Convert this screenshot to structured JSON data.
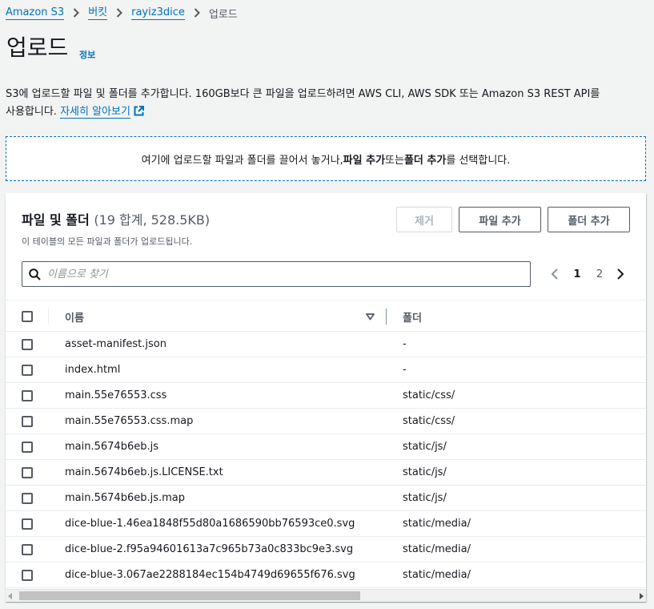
{
  "breadcrumb": {
    "items": [
      "Amazon S3",
      "버킷",
      "rayiz3dice"
    ],
    "current": "업로드"
  },
  "page": {
    "title": "업로드",
    "info": "정보"
  },
  "description": {
    "line1": "S3에 업로드할 파일 및 폴더를 추가합니다. 160GB보다 큰 파일을 업로드하려면 AWS CLI, AWS SDK 또는 Amazon S3 REST API를",
    "line2": "사용합니다.",
    "more_link": "자세히 알아보기"
  },
  "dropzone": {
    "pre": "여기에 업로드할 파일과 폴더를 끌어서 놓거나, ",
    "add_files": "파일 추가",
    "mid": " 또는 ",
    "add_folder": "폴더 추가",
    "post": "를 선택합니다."
  },
  "panel": {
    "title": "파일 및 폴더",
    "count": "(19 합계, 528.5KB)",
    "subtitle": "이 테이블의 모든 파일과 폴더가 업로드됩니다.",
    "remove_label": "제거",
    "add_files_label": "파일 추가",
    "add_folder_label": "폴더 추가"
  },
  "search": {
    "placeholder": "이름으로 찾기"
  },
  "pagination": {
    "pages": [
      "1",
      "2"
    ],
    "current": "1"
  },
  "table": {
    "columns": {
      "name": "이름",
      "folder": "폴더"
    },
    "rows": [
      {
        "name": "asset-manifest.json",
        "folder": "-"
      },
      {
        "name": "index.html",
        "folder": "-"
      },
      {
        "name": "main.55e76553.css",
        "folder": "static/css/"
      },
      {
        "name": "main.55e76553.css.map",
        "folder": "static/css/"
      },
      {
        "name": "main.5674b6eb.js",
        "folder": "static/js/"
      },
      {
        "name": "main.5674b6eb.js.LICENSE.txt",
        "folder": "static/js/"
      },
      {
        "name": "main.5674b6eb.js.map",
        "folder": "static/js/"
      },
      {
        "name": "dice-blue-1.46ea1848f55d80a1686590bb76593ce0.svg",
        "folder": "static/media/"
      },
      {
        "name": "dice-blue-2.f95a94601613a7c965b73a0c833bc9e3.svg",
        "folder": "static/media/"
      },
      {
        "name": "dice-blue-3.067ae2288184ec154b4749d69655f676.svg",
        "folder": "static/media/"
      }
    ]
  },
  "colors": {
    "link": "#0073bb",
    "text": "#16191f",
    "muted": "#545b64",
    "background": "#f2f3f3"
  }
}
